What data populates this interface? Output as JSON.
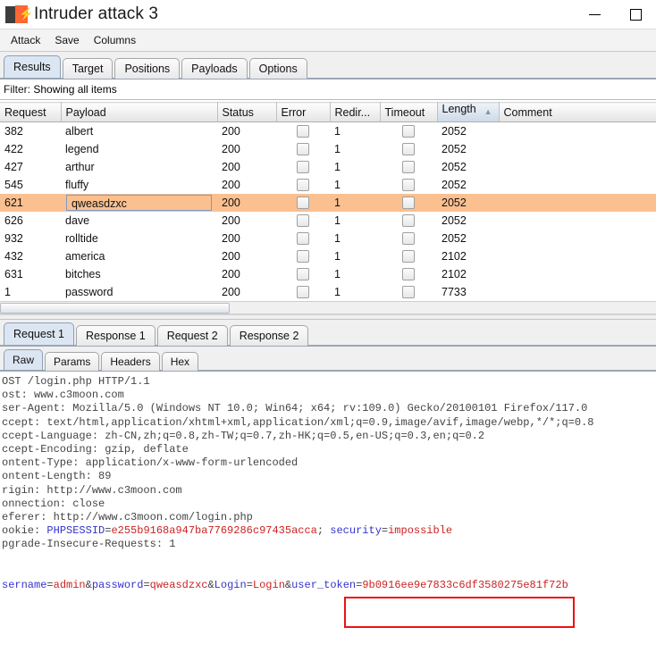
{
  "window": {
    "title": "Intruder attack 3",
    "logo_icon": "burp-suite-logo",
    "minimize_label": "—",
    "maximize_label": "□"
  },
  "menubar": {
    "items": [
      {
        "label": "Attack"
      },
      {
        "label": "Save"
      },
      {
        "label": "Columns"
      }
    ]
  },
  "top_tabs": {
    "items": [
      {
        "label": "Results",
        "active": true
      },
      {
        "label": "Target",
        "active": false
      },
      {
        "label": "Positions",
        "active": false
      },
      {
        "label": "Payloads",
        "active": false
      },
      {
        "label": "Options",
        "active": false
      }
    ]
  },
  "filter": {
    "label": "Filter:",
    "value": "Showing all items"
  },
  "results_table": {
    "columns": [
      {
        "key": "request",
        "label": "Request",
        "sorted": false
      },
      {
        "key": "payload",
        "label": "Payload",
        "sorted": false
      },
      {
        "key": "status",
        "label": "Status",
        "sorted": false
      },
      {
        "key": "error",
        "label": "Error",
        "sorted": false
      },
      {
        "key": "redirect",
        "label": "Redir...",
        "sorted": false
      },
      {
        "key": "timeout",
        "label": "Timeout",
        "sorted": false
      },
      {
        "key": "length",
        "label": "Length",
        "sorted": true,
        "sort_direction": "ascending",
        "sort_arrow": "▲"
      },
      {
        "key": "comment",
        "label": "Comment",
        "sorted": false
      }
    ],
    "rows": [
      {
        "request": "382",
        "payload": "albert",
        "status": "200",
        "error": false,
        "redirect": "1",
        "timeout": false,
        "length": "2052",
        "comment": "",
        "selected": false
      },
      {
        "request": "422",
        "payload": "legend",
        "status": "200",
        "error": false,
        "redirect": "1",
        "timeout": false,
        "length": "2052",
        "comment": "",
        "selected": false
      },
      {
        "request": "427",
        "payload": "arthur",
        "status": "200",
        "error": false,
        "redirect": "1",
        "timeout": false,
        "length": "2052",
        "comment": "",
        "selected": false
      },
      {
        "request": "545",
        "payload": "fluffy",
        "status": "200",
        "error": false,
        "redirect": "1",
        "timeout": false,
        "length": "2052",
        "comment": "",
        "selected": false
      },
      {
        "request": "621",
        "payload": "qweasdzxc",
        "status": "200",
        "error": false,
        "redirect": "1",
        "timeout": false,
        "length": "2052",
        "comment": "",
        "selected": true
      },
      {
        "request": "626",
        "payload": "dave",
        "status": "200",
        "error": false,
        "redirect": "1",
        "timeout": false,
        "length": "2052",
        "comment": "",
        "selected": false
      },
      {
        "request": "932",
        "payload": "rolltide",
        "status": "200",
        "error": false,
        "redirect": "1",
        "timeout": false,
        "length": "2052",
        "comment": "",
        "selected": false
      },
      {
        "request": "432",
        "payload": "america",
        "status": "200",
        "error": false,
        "redirect": "1",
        "timeout": false,
        "length": "2102",
        "comment": "",
        "selected": false
      },
      {
        "request": "631",
        "payload": "bitches",
        "status": "200",
        "error": false,
        "redirect": "1",
        "timeout": false,
        "length": "2102",
        "comment": "",
        "selected": false
      },
      {
        "request": "1",
        "payload": "password",
        "status": "200",
        "error": false,
        "redirect": "1",
        "timeout": false,
        "length": "7733",
        "comment": "",
        "selected": false
      }
    ]
  },
  "message_tabs": {
    "items": [
      {
        "label": "Request 1",
        "active": true
      },
      {
        "label": "Response 1",
        "active": false
      },
      {
        "label": "Request 2",
        "active": false
      },
      {
        "label": "Response 2",
        "active": false
      }
    ]
  },
  "message_subtabs": {
    "items": [
      {
        "label": "Raw",
        "active": true
      },
      {
        "label": "Params",
        "active": false
      },
      {
        "label": "Headers",
        "active": false
      },
      {
        "label": "Hex",
        "active": false
      }
    ]
  },
  "raw_request": {
    "lines": [
      {
        "text": "OST /login.php HTTP/1.1",
        "color": "black"
      },
      {
        "text": "ost: www.c3moon.com",
        "color": "black"
      },
      {
        "text": "ser-Agent: Mozilla/5.0 (Windows NT 10.0; Win64; x64; rv:109.0) Gecko/20100101 Firefox/117.0",
        "color": "black"
      },
      {
        "text": "ccept: text/html,application/xhtml+xml,application/xml;q=0.9,image/avif,image/webp,*/*;q=0.8",
        "color": "black"
      },
      {
        "text": "ccept-Language: zh-CN,zh;q=0.8,zh-TW;q=0.7,zh-HK;q=0.5,en-US;q=0.3,en;q=0.2",
        "color": "black"
      },
      {
        "text": "ccept-Encoding: gzip, deflate",
        "color": "black"
      },
      {
        "text": "ontent-Type: application/x-www-form-urlencoded",
        "color": "black"
      },
      {
        "text": "ontent-Length: 89",
        "color": "black"
      },
      {
        "text": "rigin: http://www.c3moon.com",
        "color": "black"
      },
      {
        "text": "onnection: close",
        "color": "black"
      },
      {
        "text": "eferer: http://www.c3moon.com/login.php",
        "color": "black"
      },
      {
        "text": "ookie: ",
        "color": "black"
      },
      {
        "text": "pgrade-Insecure-Requests: 1",
        "color": "black"
      },
      {
        "text": "",
        "color": "black"
      },
      {
        "text": "",
        "color": "black"
      }
    ],
    "cookie_line": {
      "prefix": "ookie: ",
      "name1": "PHPSESSID",
      "eq": "=",
      "value1": "e255b9168a947ba7769286c97435acca",
      "sep": "; ",
      "name2": "security",
      "value2": "impossible"
    },
    "body_line": {
      "p1_name": "sername",
      "p1_value": "admin",
      "p2_name": "password",
      "p2_value": "qweasdzxc",
      "p3_name": "Login",
      "p3_value": "Login",
      "p4_name": "user_token",
      "p4_value": "9b0916ee9e7833c6df3580275e81f72b"
    },
    "highlight_box_color": "#ee1111"
  }
}
